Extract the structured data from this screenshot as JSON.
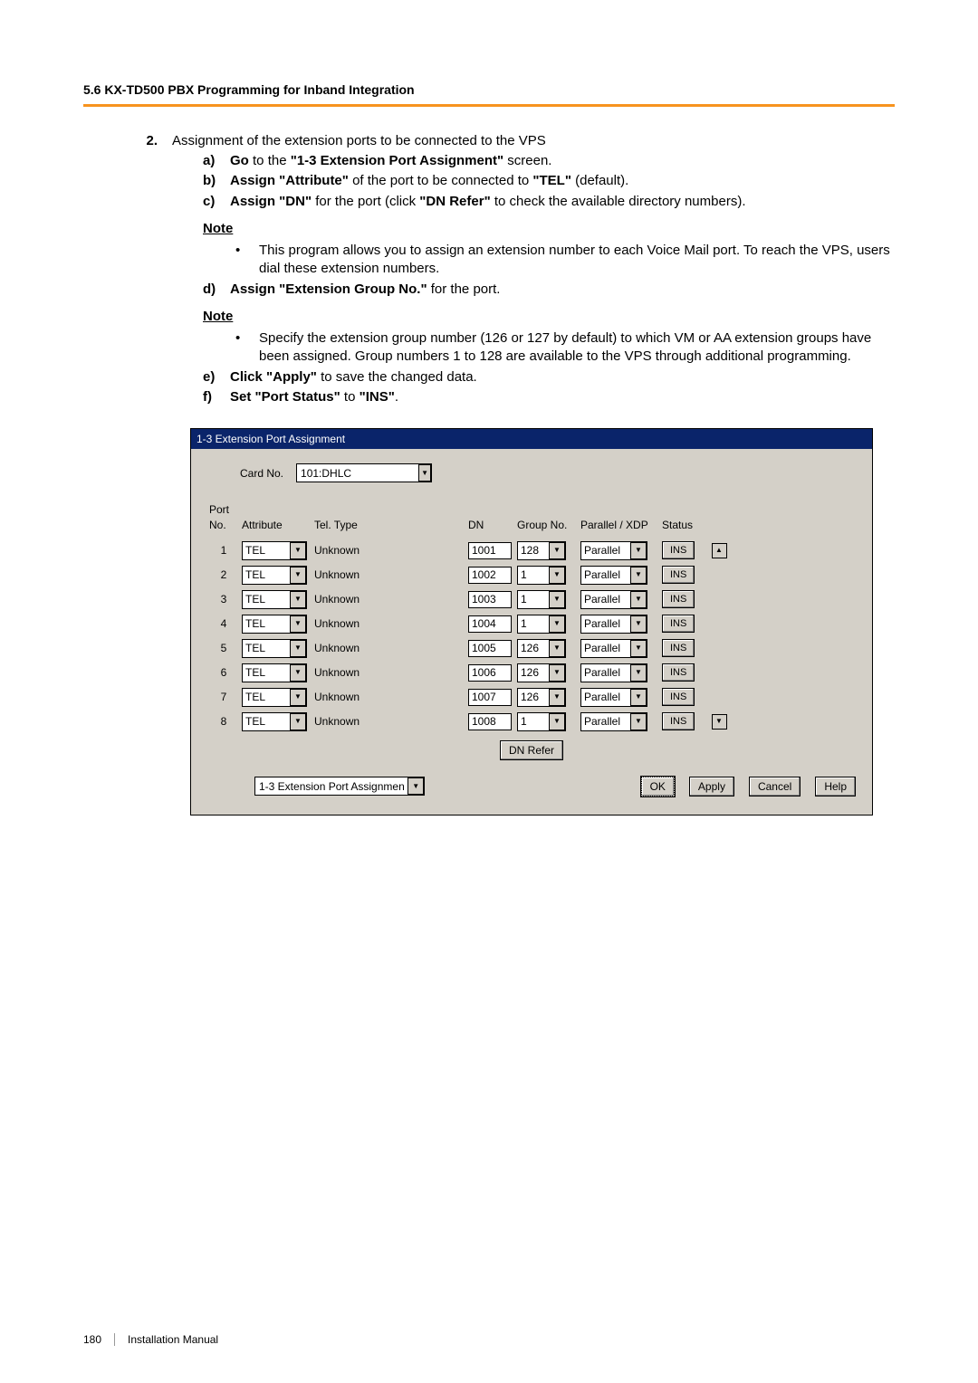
{
  "header": {
    "section": "5.6 KX-TD500 PBX Programming for Inband Integration"
  },
  "step": {
    "num": "2.",
    "intro": "Assignment of the extension ports to be connected to the VPS",
    "a_letter": "a)",
    "a_bold1": "Go",
    "a_txt1": " to the ",
    "a_bold2": "\"1-3 Extension Port Assignment\"",
    "a_txt2": " screen.",
    "b_letter": "b)",
    "b_bold1": "Assign \"Attribute\"",
    "b_txt1": " of the port to be connected to ",
    "b_bold2": "\"TEL\"",
    "b_txt2": " (default).",
    "c_letter": "c)",
    "c_bold1": "Assign \"DN\"",
    "c_txt1": " for the port (click ",
    "c_bold2": "\"DN Refer\"",
    "c_txt2": " to check the available directory numbers).",
    "note1_label": "Note",
    "note1_text": "This program allows you to assign an extension number to each Voice Mail port. To reach the VPS, users dial these extension numbers.",
    "d_letter": "d)",
    "d_bold1": "Assign \"Extension Group No.\"",
    "d_txt1": " for the port.",
    "note2_label": "Note",
    "note2_text": "Specify the extension group number (126 or 127 by default) to which VM or AA extension groups have been assigned. Group numbers 1 to 128 are available to the VPS through additional programming.",
    "e_letter": "e)",
    "e_bold1": "Click \"Apply\"",
    "e_txt1": " to save the changed data.",
    "f_letter": "f)",
    "f_bold1": "Set \"Port Status\"",
    "f_txt1": " to ",
    "f_bold2": "\"INS\"",
    "f_txt2": "."
  },
  "win": {
    "title": "1-3 Extension Port Assignment",
    "card_label": "Card No.",
    "card_value": "101:DHLC",
    "cols": {
      "port": "Port No.",
      "attr": "Attribute",
      "tel": "Tel. Type",
      "dn": "DN",
      "group": "Group No.",
      "pxdp": "Parallel / XDP",
      "status": "Status"
    },
    "rows": [
      {
        "n": "1",
        "attr": "TEL",
        "tel": "Unknown",
        "dn": "1001",
        "grp": "128",
        "px": "Parallel",
        "st": "INS"
      },
      {
        "n": "2",
        "attr": "TEL",
        "tel": "Unknown",
        "dn": "1002",
        "grp": "1",
        "px": "Parallel",
        "st": "INS"
      },
      {
        "n": "3",
        "attr": "TEL",
        "tel": "Unknown",
        "dn": "1003",
        "grp": "1",
        "px": "Parallel",
        "st": "INS"
      },
      {
        "n": "4",
        "attr": "TEL",
        "tel": "Unknown",
        "dn": "1004",
        "grp": "1",
        "px": "Parallel",
        "st": "INS"
      },
      {
        "n": "5",
        "attr": "TEL",
        "tel": "Unknown",
        "dn": "1005",
        "grp": "126",
        "px": "Parallel",
        "st": "INS"
      },
      {
        "n": "6",
        "attr": "TEL",
        "tel": "Unknown",
        "dn": "1006",
        "grp": "126",
        "px": "Parallel",
        "st": "INS"
      },
      {
        "n": "7",
        "attr": "TEL",
        "tel": "Unknown",
        "dn": "1007",
        "grp": "126",
        "px": "Parallel",
        "st": "INS"
      },
      {
        "n": "8",
        "attr": "TEL",
        "tel": "Unknown",
        "dn": "1008",
        "grp": "1",
        "px": "Parallel",
        "st": "INS"
      }
    ],
    "dn_refer": "DN Refer",
    "screen_select": "1-3 Extension Port Assignment",
    "ok": "OK",
    "apply": "Apply",
    "cancel": "Cancel",
    "help": "Help"
  },
  "footer": {
    "page": "180",
    "title": "Installation Manual"
  }
}
